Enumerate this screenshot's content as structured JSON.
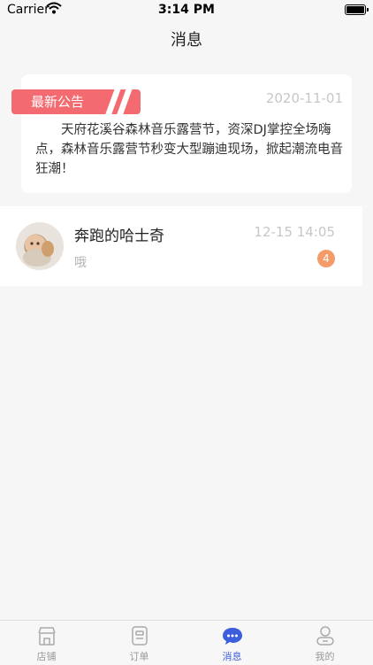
{
  "status_bar": {
    "carrier": "Carrier",
    "time": "3:14 PM"
  },
  "nav": {
    "title": "消息"
  },
  "notice": {
    "badge_label": "最新公告",
    "date": "2020-11-01",
    "text": "天府花溪谷森林音乐露营节，资深DJ掌控全场嗨点，森林音乐露营节秒变大型蹦迪现场，掀起潮流电音狂潮！"
  },
  "messages": [
    {
      "name": "奔跑的哈士奇",
      "time": "12-15 14:05",
      "preview": "哦",
      "unread": "4"
    }
  ],
  "tabs": [
    {
      "label": "店铺",
      "icon": "store-icon",
      "active": false
    },
    {
      "label": "订单",
      "icon": "order-icon",
      "active": false
    },
    {
      "label": "消息",
      "icon": "chat-icon",
      "active": true
    },
    {
      "label": "我的",
      "icon": "profile-icon",
      "active": false
    }
  ],
  "colors": {
    "accent": "#3c5edc",
    "badge": "#f36b70",
    "unread": "#f39b69"
  }
}
